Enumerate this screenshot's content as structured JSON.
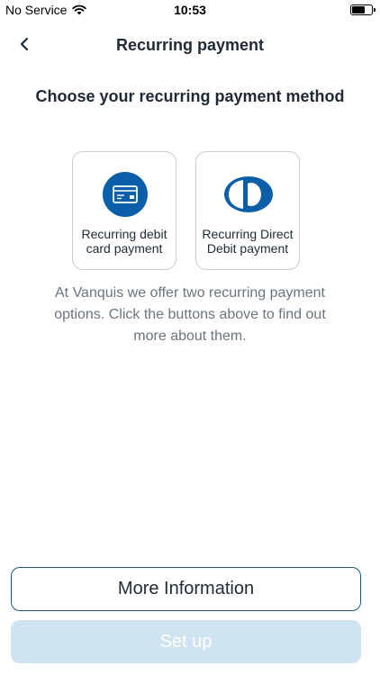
{
  "status_bar": {
    "carrier": "No Service",
    "time": "10:53"
  },
  "nav": {
    "title": "Recurring payment"
  },
  "heading": "Choose your recurring payment method",
  "options": [
    {
      "label_line1": "Recurring debit",
      "label_line2": "card payment",
      "icon": "debit-card-icon"
    },
    {
      "label_line1": "Recurring Direct",
      "label_line2": "Debit payment",
      "icon": "direct-debit-icon"
    }
  ],
  "description": "At Vanquis we offer two recurring payment options. Click the buttons above to find out more about them.",
  "buttons": {
    "more_info": "More Information",
    "set_up": "Set up"
  },
  "colors": {
    "brand_blue": "#0a5fa8",
    "outline": "#1b5a8a",
    "disabled_button": "#cfe3f1"
  }
}
